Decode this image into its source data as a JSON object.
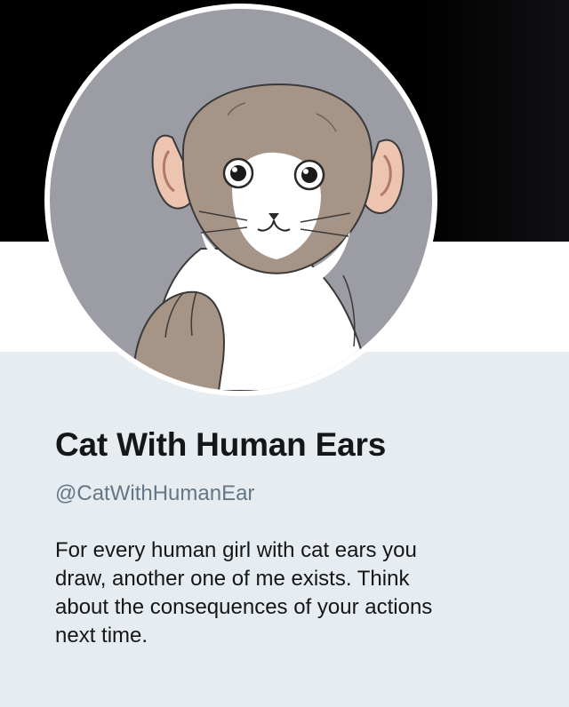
{
  "profile": {
    "display_name": "Cat With Human Ears",
    "handle": "@CatWithHumanEar",
    "bio_lines": [
      "For every human girl with cat ears you",
      "draw, another one of me exists. Think",
      "about the consequences of your actions",
      "next time."
    ]
  },
  "colors": {
    "banner": "#000000",
    "card_background": "#e6ecf0",
    "name_text": "#14171a",
    "handle_text": "#657786",
    "avatar_background": "#9b9ca4"
  }
}
